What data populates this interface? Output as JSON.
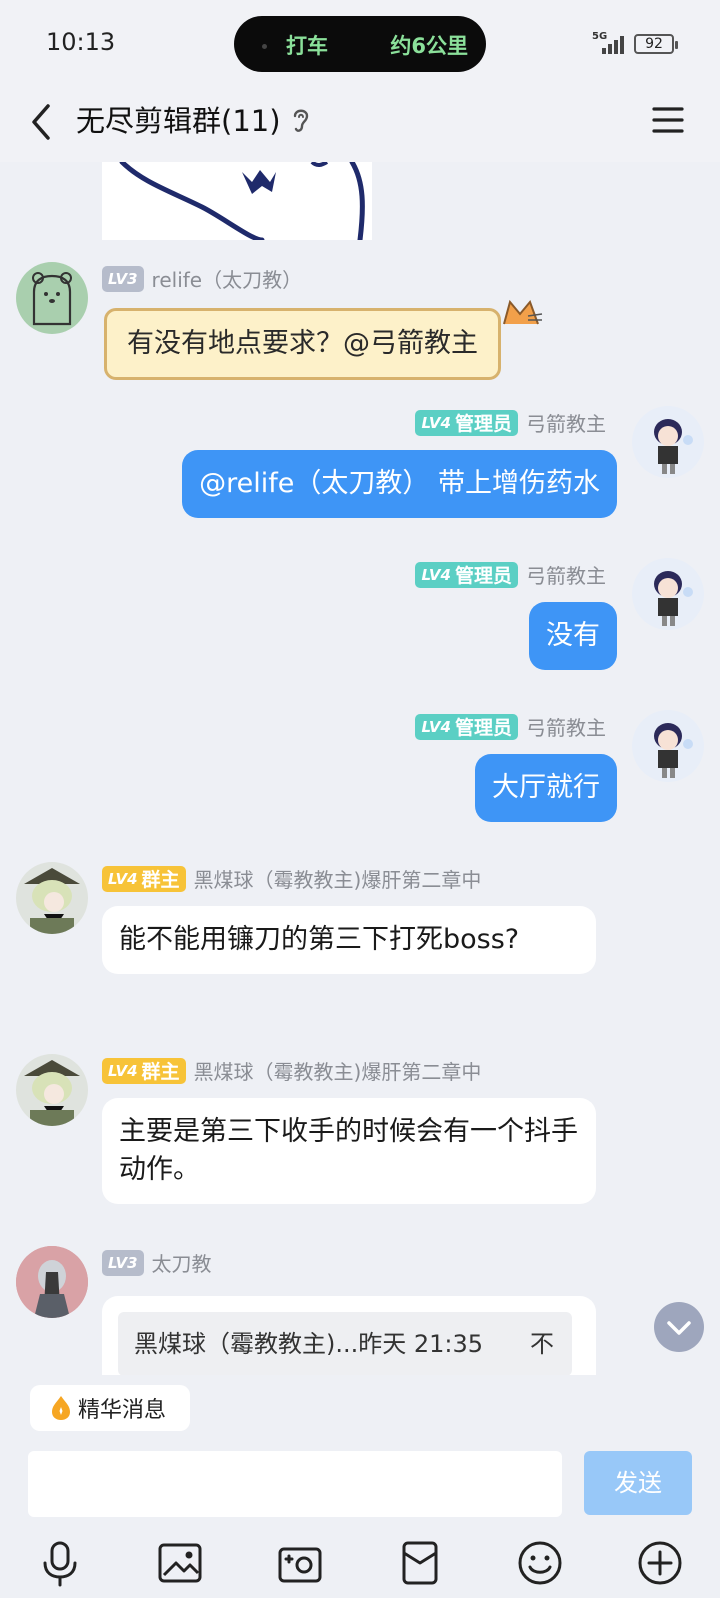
{
  "status_bar": {
    "time": "10:13",
    "island_left": "打车",
    "island_right": "约6公里",
    "network": "5G",
    "battery": "92"
  },
  "header": {
    "title": "无尽剪辑群(11)"
  },
  "messages": [
    {
      "level": "LV3",
      "role": "",
      "sender": "relife（太刀教）",
      "text": "有没有地点要求？@弓箭教主"
    },
    {
      "level": "LV4",
      "role": "管理员",
      "sender": "弓箭教主",
      "text": "@relife（太刀教） 带上增伤药水"
    },
    {
      "level": "LV4",
      "role": "管理员",
      "sender": "弓箭教主",
      "text": "没有"
    },
    {
      "level": "LV4",
      "role": "管理员",
      "sender": "弓箭教主",
      "text": "大厅就行"
    },
    {
      "level": "LV4",
      "role": "群主",
      "sender": "黑煤球（霉教教主)爆肝第二章中",
      "text": "能不能用镰刀的第三下打死boss?"
    },
    {
      "level": "LV4",
      "role": "群主",
      "sender": "黑煤球（霉教教主)爆肝第二章中",
      "text": "主要是第三下收手的时候会有一个抖手动作。"
    },
    {
      "level": "LV3",
      "role": "",
      "sender": "太刀教",
      "quote": "黑煤球（霉教教主)...昨天 21:35"
    }
  ],
  "quote_arrow": "不",
  "bottom": {
    "essence_label": "精华消息",
    "input_value": "",
    "send_label": "发送"
  },
  "colors": {
    "accent_blue": "#3e95f6",
    "admin_badge": "#5bcfc4",
    "owner_badge": "#f7c338",
    "lv3_badge": "#b6bccb"
  }
}
